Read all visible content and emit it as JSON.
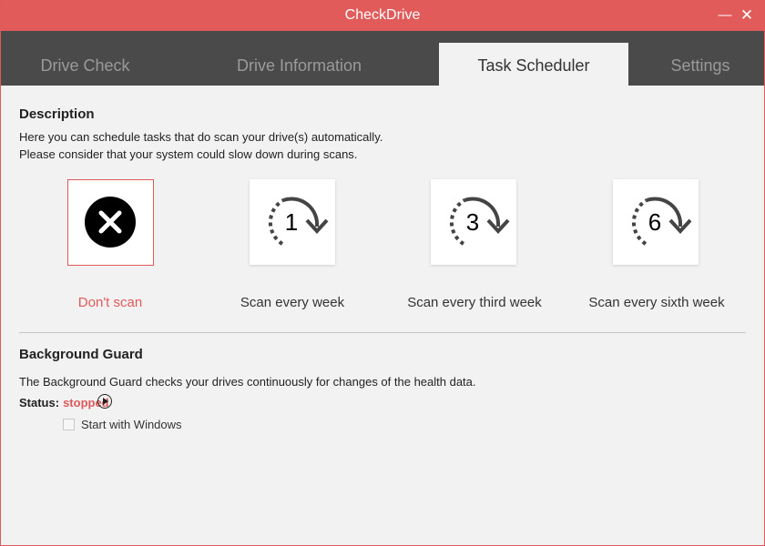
{
  "window": {
    "title": "CheckDrive",
    "minimize_glyph": "—",
    "close_glyph": "✕"
  },
  "tabs": [
    {
      "label": "Drive Check",
      "active": false
    },
    {
      "label": "Drive Information",
      "active": false
    },
    {
      "label": "Task Scheduler",
      "active": true
    },
    {
      "label": "Settings",
      "active": false
    }
  ],
  "description": {
    "heading": "Description",
    "line1": "Here you can schedule tasks that do scan your drive(s) automatically.",
    "line2": "Please consider that your system could slow down during scans."
  },
  "schedule_options": [
    {
      "label": "Don't scan",
      "icon": "close-circle-icon",
      "selected": true
    },
    {
      "label": "Scan every week",
      "icon_number": "1",
      "icon": "repeat-icon",
      "selected": false
    },
    {
      "label": "Scan every third week",
      "icon_number": "3",
      "icon": "repeat-icon",
      "selected": false
    },
    {
      "label": "Scan every sixth week",
      "icon_number": "6",
      "icon": "repeat-icon",
      "selected": false
    }
  ],
  "background_guard": {
    "heading": "Background Guard",
    "description": "The Background Guard checks your drives continuously for changes of the health data.",
    "status_label": "Status:",
    "status_value": "stopped",
    "start_with_windows_label": "Start with Windows",
    "start_with_windows_checked": false
  },
  "colors": {
    "accent": "#e25b5b",
    "tabbar": "#4a4a4a",
    "background": "#f2f2f2"
  }
}
